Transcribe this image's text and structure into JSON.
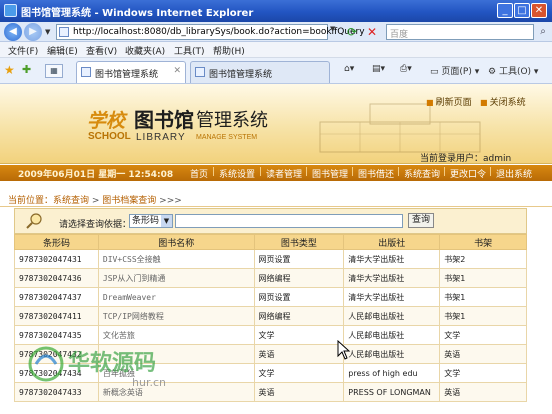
{
  "window": {
    "title": "图书馆管理系统 - Windows Internet Explorer",
    "min": "_",
    "max": "□",
    "close": "✕"
  },
  "address": {
    "url": "http://localhost:8080/db_librarySys/book.do?action=bookifQuery",
    "search_placeholder": "百度",
    "go": "▼"
  },
  "menu": [
    "文件(F)",
    "编辑(E)",
    "查看(V)",
    "收藏夹(A)",
    "工具(T)",
    "帮助(H)"
  ],
  "tabs": [
    {
      "label": "图书馆管理系统",
      "active": true
    },
    {
      "label": "图书馆管理系统",
      "active": false
    }
  ],
  "toolbar": {
    "page": "页面(P)",
    "tools": "工具(O)"
  },
  "icons": {
    "back": "back-arrow-icon",
    "forward": "forward-arrow-icon",
    "refresh": "refresh-icon",
    "stop": "stop-icon",
    "search": "search-icon",
    "favorites": "star-icon",
    "add_favorite": "add-favorite-icon",
    "home": "home-icon",
    "feeds": "feeds-icon",
    "print": "print-icon",
    "tab_close": "close-icon"
  },
  "colors": {
    "accent_orange": "#c97706",
    "header_gold": "#f6d68c",
    "ie_blue": "#2255c2"
  },
  "banner": {
    "logo_xuexiao": "学校",
    "logo_school": "SCHOOL",
    "logo_tsg": "图书馆",
    "logo_glxt": "管理系统",
    "logo_library": "LIBRARY",
    "logo_manage": "MANAGE SYSTEM",
    "refresh": "刷新页面",
    "close": "关闭系统",
    "current_user": "当前登录用户：admin"
  },
  "nav": {
    "datetime": "2009年06月01日 星期一 12:54:08",
    "items": [
      "首页",
      "系统设置",
      "读者管理",
      "图书管理",
      "图书借还",
      "系统查询",
      "更改口令",
      "退出系统"
    ]
  },
  "breadcrumb": {
    "prefix": "当前位置：",
    "section": "系统查询",
    "sep": " > ",
    "page": "图书档案查询",
    "tail": " >>>"
  },
  "query": {
    "label": "请选择查询依据：",
    "select_value": "条形码",
    "input_value": "",
    "button": "查询"
  },
  "table": {
    "headers": [
      "条形码",
      "图书名称",
      "图书类型",
      "出版社",
      "书架"
    ],
    "rows": [
      [
        "9787302047431",
        "DIV+CSS全接触",
        "网页设置",
        "清华大学出版社",
        "书架2"
      ],
      [
        "9787302047436",
        "JSP从入门到精通",
        "网络编程",
        "清华大学出版社",
        "书架1"
      ],
      [
        "9787302047437",
        "DreamWeaver",
        "网页设置",
        "清华大学出版社",
        "书架1"
      ],
      [
        "9787302047411",
        "TCP/IP网络教程",
        "网络编程",
        "人民邮电出版社",
        "书架1"
      ],
      [
        "9787302047435",
        "文化苦旅",
        "文学",
        "人民邮电出版社",
        "文学"
      ],
      [
        "9787302047432",
        "",
        "英语",
        "人民邮电出版社",
        "英语"
      ],
      [
        "9787302047434",
        "百年孤独",
        "文学",
        "press of high edu",
        "文学"
      ],
      [
        "9787302047433",
        "新概念英语",
        "英语",
        "PRESS OF LONGMAN",
        "英语"
      ]
    ]
  },
  "watermark": {
    "text": "华软源码",
    "sub": "hur.cn"
  }
}
